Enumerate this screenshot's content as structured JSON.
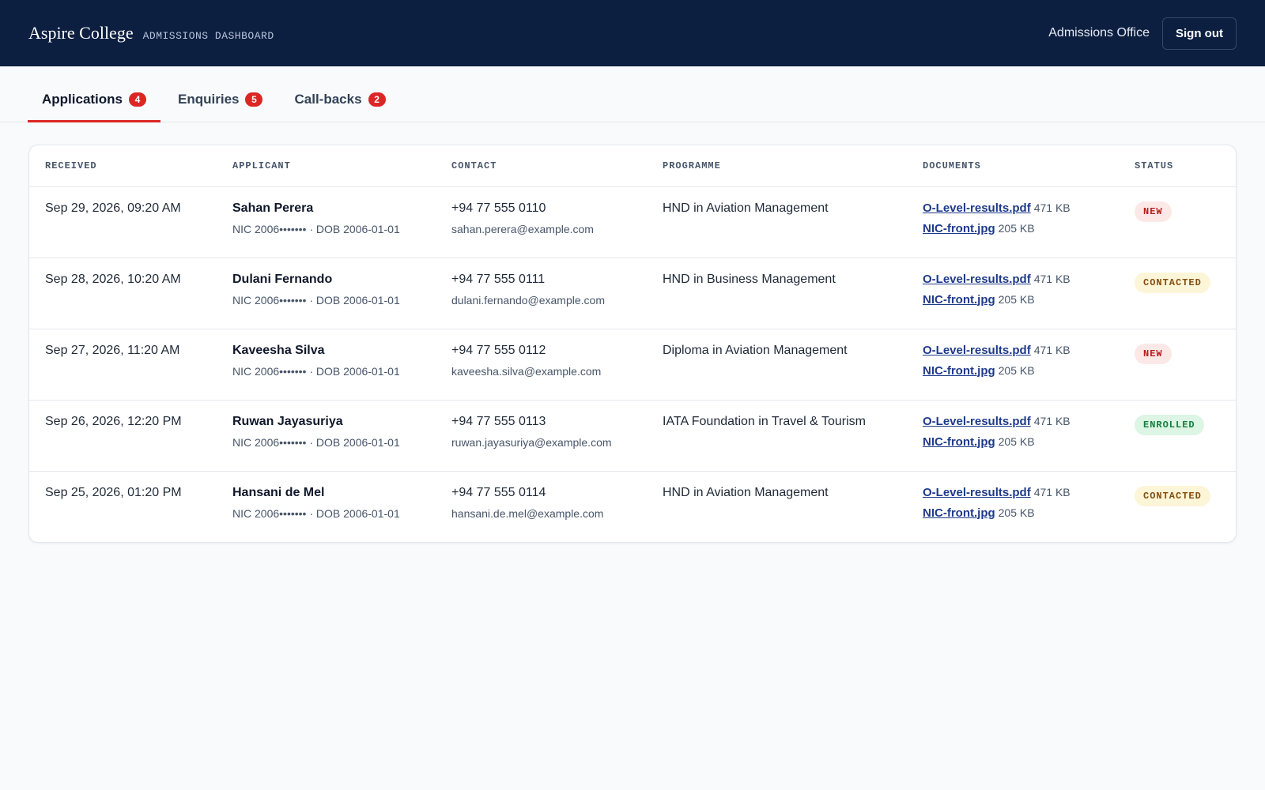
{
  "header": {
    "brand": "Aspire College",
    "subtitle": "ADMISSIONS DASHBOARD",
    "office": "Admissions Office",
    "signout_label": "Sign out"
  },
  "tabs": [
    {
      "label": "Applications",
      "count": "4",
      "active": true
    },
    {
      "label": "Enquiries",
      "count": "5",
      "active": false
    },
    {
      "label": "Call-backs",
      "count": "2",
      "active": false
    }
  ],
  "table": {
    "columns": [
      "RECEIVED",
      "APPLICANT",
      "CONTACT",
      "PROGRAMME",
      "DOCUMENTS",
      "STATUS"
    ],
    "rows": [
      {
        "received": "Sep 29, 2026, 09:20 AM",
        "name": "Sahan Perera",
        "ids": "NIC 2006••••••• · DOB 2006-01-01",
        "phone": "+94 77 555 0110",
        "email": "sahan.perera@example.com",
        "programme": "HND in Aviation Management",
        "docs": [
          {
            "name": "O-Level-results.pdf",
            "size": "471 KB"
          },
          {
            "name": "NIC-front.jpg",
            "size": "205 KB"
          }
        ],
        "status": "NEW",
        "status_kind": "new"
      },
      {
        "received": "Sep 28, 2026, 10:20 AM",
        "name": "Dulani Fernando",
        "ids": "NIC 2006••••••• · DOB 2006-01-01",
        "phone": "+94 77 555 0111",
        "email": "dulani.fernando@example.com",
        "programme": "HND in Business Management",
        "docs": [
          {
            "name": "O-Level-results.pdf",
            "size": "471 KB"
          },
          {
            "name": "NIC-front.jpg",
            "size": "205 KB"
          }
        ],
        "status": "CONTACTED",
        "status_kind": "contacted"
      },
      {
        "received": "Sep 27, 2026, 11:20 AM",
        "name": "Kaveesha Silva",
        "ids": "NIC 2006••••••• · DOB 2006-01-01",
        "phone": "+94 77 555 0112",
        "email": "kaveesha.silva@example.com",
        "programme": "Diploma in Aviation Management",
        "docs": [
          {
            "name": "O-Level-results.pdf",
            "size": "471 KB"
          },
          {
            "name": "NIC-front.jpg",
            "size": "205 KB"
          }
        ],
        "status": "NEW",
        "status_kind": "new"
      },
      {
        "received": "Sep 26, 2026, 12:20 PM",
        "name": "Ruwan Jayasuriya",
        "ids": "NIC 2006••••••• · DOB 2006-01-01",
        "phone": "+94 77 555 0113",
        "email": "ruwan.jayasuriya@example.com",
        "programme": "IATA Foundation in Travel & Tourism",
        "docs": [
          {
            "name": "O-Level-results.pdf",
            "size": "471 KB"
          },
          {
            "name": "NIC-front.jpg",
            "size": "205 KB"
          }
        ],
        "status": "ENROLLED",
        "status_kind": "enrolled"
      },
      {
        "received": "Sep 25, 2026, 01:20 PM",
        "name": "Hansani de Mel",
        "ids": "NIC 2006••••••• · DOB 2006-01-01",
        "phone": "+94 77 555 0114",
        "email": "hansani.de.mel@example.com",
        "programme": "HND in Aviation Management",
        "docs": [
          {
            "name": "O-Level-results.pdf",
            "size": "471 KB"
          },
          {
            "name": "NIC-front.jpg",
            "size": "205 KB"
          }
        ],
        "status": "CONTACTED",
        "status_kind": "contacted"
      }
    ]
  },
  "colors": {
    "header_bg": "#0d1f40",
    "accent": "#dc2626",
    "link": "#1e3a8a"
  }
}
